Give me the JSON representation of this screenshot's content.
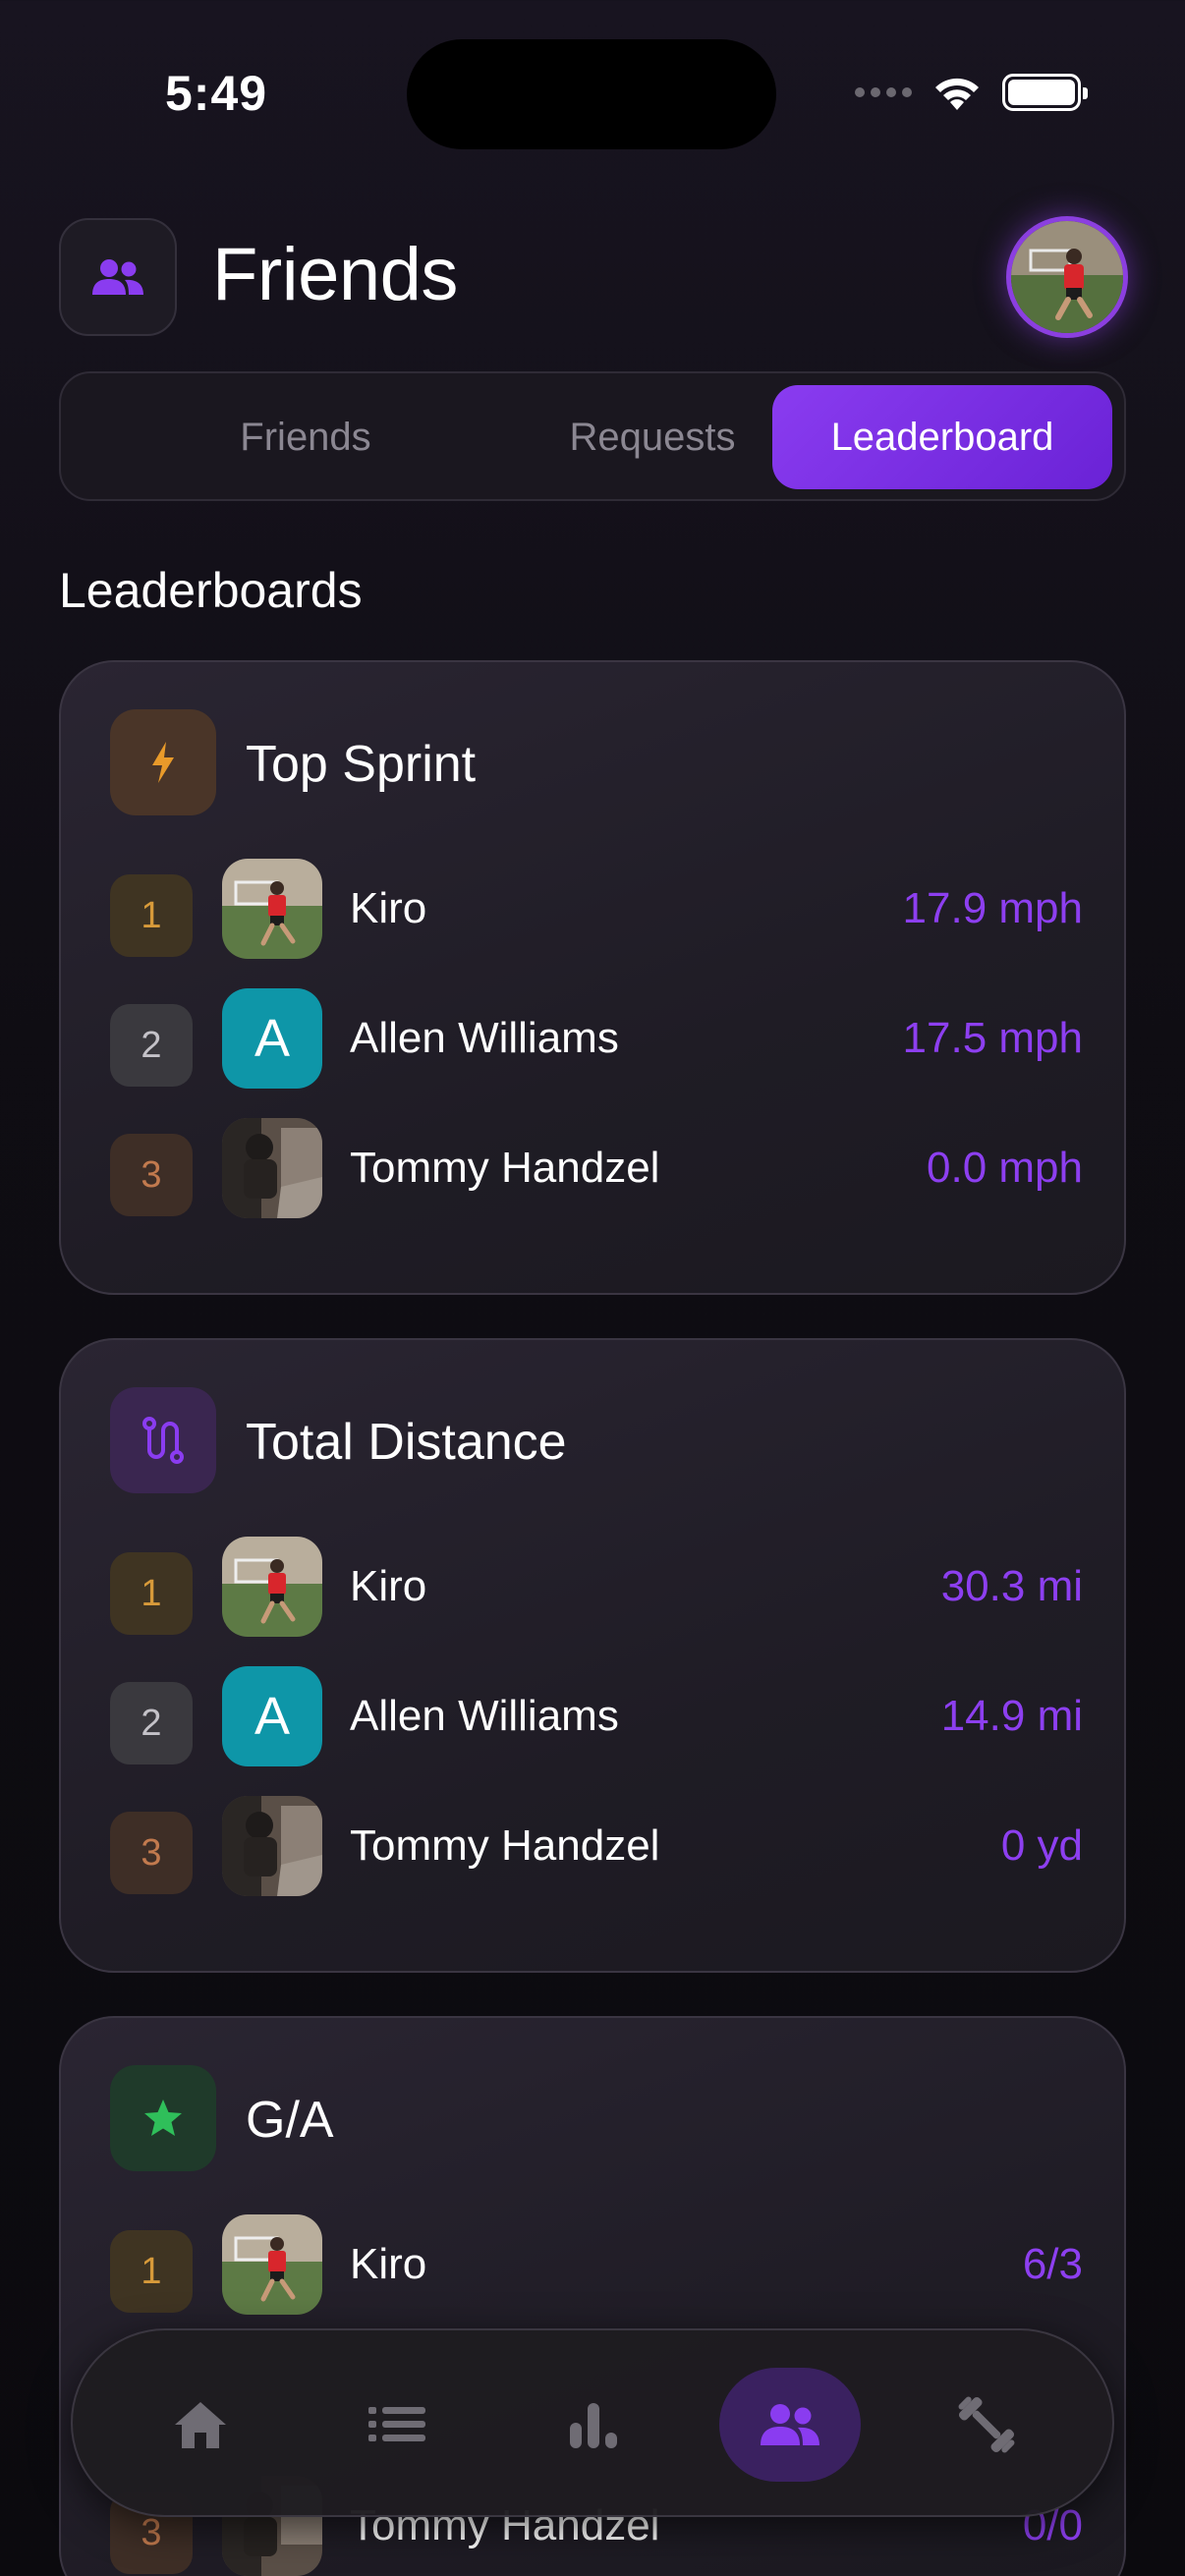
{
  "status_bar": {
    "time": "5:49"
  },
  "header": {
    "title": "Friends"
  },
  "tabs": [
    {
      "label": "Friends",
      "active": false
    },
    {
      "label": "Requests",
      "active": false
    },
    {
      "label": "Leaderboard",
      "active": true
    }
  ],
  "section_heading": "Leaderboards",
  "colors": {
    "accent": "#8a3cf0",
    "value_text": "#8d3ff0",
    "background": "#0f0d13"
  },
  "leaderboards": [
    {
      "title": "Top Sprint",
      "icon": "bolt-icon",
      "rows": [
        {
          "rank": "1",
          "name": "Kiro",
          "value": "17.9 mph",
          "avatar": "photo"
        },
        {
          "rank": "2",
          "name": "Allen Williams",
          "value": "17.5 mph",
          "avatar": "A"
        },
        {
          "rank": "3",
          "name": "Tommy Handzel",
          "value": "0.0 mph",
          "avatar": "photo"
        }
      ]
    },
    {
      "title": "Total Distance",
      "icon": "route-icon",
      "rows": [
        {
          "rank": "1",
          "name": "Kiro",
          "value": "30.3 mi",
          "avatar": "photo"
        },
        {
          "rank": "2",
          "name": "Allen Williams",
          "value": "14.9 mi",
          "avatar": "A"
        },
        {
          "rank": "3",
          "name": "Tommy Handzel",
          "value": "0 yd",
          "avatar": "photo"
        }
      ]
    },
    {
      "title": "G/A",
      "icon": "star-icon",
      "rows": [
        {
          "rank": "1",
          "name": "Kiro",
          "value": "6/3",
          "avatar": "photo"
        },
        {
          "rank": "3",
          "name": "Tommy Handzel",
          "value": "0/0",
          "avatar": "photo"
        }
      ]
    }
  ],
  "bottom_nav": [
    {
      "icon": "home-icon",
      "active": false
    },
    {
      "icon": "list-icon",
      "active": false
    },
    {
      "icon": "bar-chart-icon",
      "active": false
    },
    {
      "icon": "friends-icon",
      "active": true
    },
    {
      "icon": "dumbbell-icon",
      "active": false
    }
  ]
}
